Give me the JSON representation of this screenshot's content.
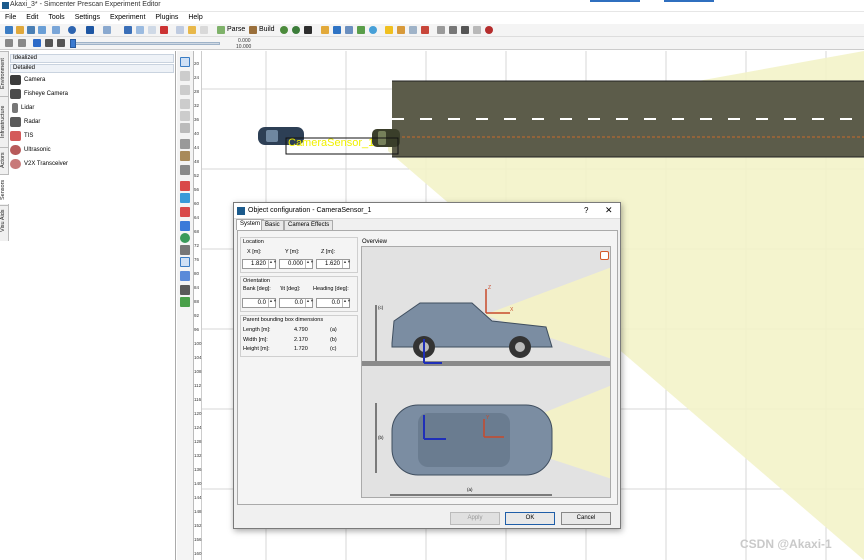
{
  "window": {
    "title": "Akaxi_3* - Simcenter Prescan Experiment Editor"
  },
  "menu": [
    "File",
    "Edit",
    "Tools",
    "Settings",
    "Experiment",
    "Plugins",
    "Help"
  ],
  "toolbar": {
    "parse_label": "Parse",
    "build_label": "Build"
  },
  "timeline": {
    "start": "0.000",
    "end": "10.000"
  },
  "left_panel": {
    "tabs": [
      "Environment",
      "Infrastructure",
      "Actors",
      "Sensors",
      "Visu Aids"
    ],
    "modes": [
      "Idealized",
      "Detailed"
    ],
    "items": [
      {
        "label": "Camera",
        "icon": "camera-icon"
      },
      {
        "label": "Fisheye Camera",
        "icon": "fisheye-camera-icon"
      },
      {
        "label": "Lidar",
        "icon": "lidar-icon"
      },
      {
        "label": "Radar",
        "icon": "radar-icon"
      },
      {
        "label": "TIS",
        "icon": "tis-icon"
      },
      {
        "label": "Ultrasonic",
        "icon": "ultrasonic-icon"
      },
      {
        "label": "V2X Transceiver",
        "icon": "v2x-icon"
      }
    ]
  },
  "ruler": {
    "ticks": [
      "20",
      "24",
      "28",
      "32",
      "36",
      "40",
      "44",
      "48",
      "52",
      "56",
      "60",
      "64",
      "68",
      "72",
      "76",
      "80",
      "84",
      "88",
      "92",
      "96",
      "100",
      "104",
      "108",
      "112",
      "116",
      "120",
      "124",
      "128",
      "132",
      "136",
      "140",
      "144",
      "148",
      "152",
      "156",
      "160"
    ]
  },
  "scene": {
    "sensor_label": "CameraSensor_1"
  },
  "dialog": {
    "title": "Object configuration - CameraSensor_1",
    "help_glyph": "?",
    "close_glyph": "✕",
    "tabs": [
      "System",
      "Basic",
      "Camera Effects"
    ],
    "location": {
      "label": "Location",
      "x_label": "X  [m]:",
      "x": "1.820",
      "y_label": "Y [m]:",
      "y": "0.000",
      "z_label": "Z [m]:",
      "z": "1.620"
    },
    "orientation": {
      "label": "Orientation",
      "bank_label": "Bank [deg]:",
      "bank": "0.0",
      "tilt_label": "'ilt [deg]:",
      "tilt": "0.0",
      "heading_label": "Heading [deg]:",
      "heading": "0.0"
    },
    "parent_bbox": {
      "label": "Parent bounding box dimensions",
      "rows": [
        {
          "name": "Length [m]:",
          "value": "4.790",
          "key": "(a)"
        },
        {
          "name": "Width [m]:",
          "value": "2.170",
          "key": "(b)"
        },
        {
          "name": "Height [m]:",
          "value": "1.720",
          "key": "(c)"
        }
      ]
    },
    "overview": {
      "label": "Overview",
      "dim_c": "(c)",
      "dim_b": "(b)",
      "dim_a": "(a)",
      "axis_x": "X",
      "axis_y": "Y",
      "axis_z": "Z"
    },
    "buttons": {
      "apply": "Apply",
      "ok": "OK",
      "cancel": "Cancel"
    }
  },
  "watermark": "CSDN @Akaxi-1"
}
